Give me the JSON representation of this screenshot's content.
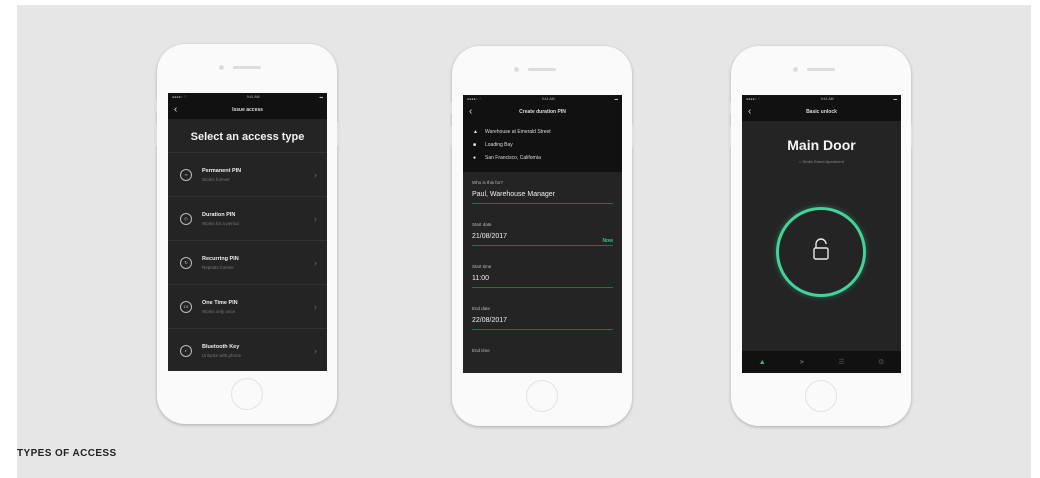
{
  "caption": "TYPES OF ACCESS",
  "accent_color": "#31c47a",
  "phone1": {
    "status_time": "9:41 AM",
    "nav_title": "Issue access",
    "heading": "Select an access type",
    "items": [
      {
        "icon": "infinity-icon",
        "icon_text": "∞",
        "name": "Permanent PIN",
        "sub": "Works forever"
      },
      {
        "icon": "clock-icon",
        "icon_text": "◴",
        "name": "Duration PIN",
        "sub": "Works for a period"
      },
      {
        "icon": "repeat-icon",
        "icon_text": "↻",
        "name": "Recurring PIN",
        "sub": "Repeats forever"
      },
      {
        "icon": "one-time-icon",
        "icon_text": "1X",
        "name": "One Time PIN",
        "sub": "Works only once"
      },
      {
        "icon": "bluetooth-icon",
        "icon_text": "◐",
        "name": "Bluetooth Key",
        "sub": "Unlocks with phone"
      }
    ]
  },
  "phone2": {
    "status_time": "9:41 AM",
    "nav_title": "Create duration PIN",
    "locations": [
      "Warehouse at Emerald Street",
      "Loading Bay",
      "San Francisco, California"
    ],
    "fields": [
      {
        "label": "Who is this for?",
        "value": "Paul, Warehouse Manager"
      },
      {
        "label": "Start date",
        "value": "21/08/2017",
        "action": "Now"
      },
      {
        "label": "Start time",
        "value": "11:00"
      },
      {
        "label": "End date",
        "value": "22/08/2017"
      },
      {
        "label": "End time",
        "value": ""
      }
    ]
  },
  "phone3": {
    "status_time": "9:41 AM",
    "nav_title": "Basic unlock",
    "door_name": "Main Door",
    "door_sub": "Smith Street Apartment",
    "tabs": [
      "lock-icon",
      "send-icon",
      "list-icon",
      "gear-icon"
    ]
  }
}
